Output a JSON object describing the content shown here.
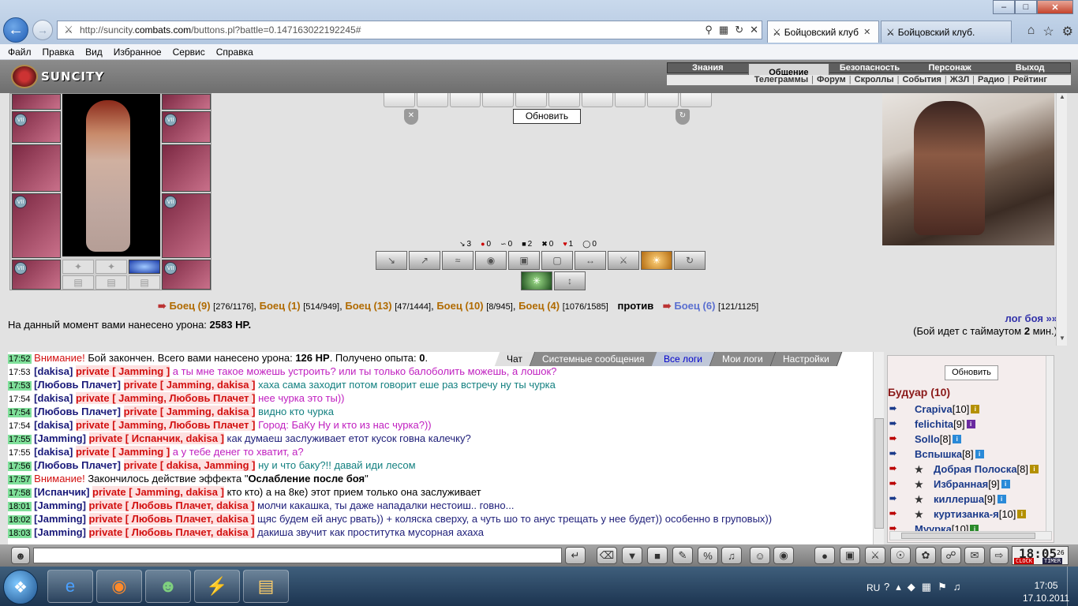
{
  "browser": {
    "url_prefix": "http://suncity.",
    "url_domain": "combats.com",
    "url_rest": "/buttons.pl?battle=0.147163022192245#",
    "tabs": [
      {
        "label": "Бойцовский клуб"
      },
      {
        "label": "Бойцовский клуб."
      }
    ],
    "menu": [
      "Файл",
      "Правка",
      "Вид",
      "Избранное",
      "Сервис",
      "Справка"
    ]
  },
  "game": {
    "logo": "SUNCITY",
    "topnav": [
      "Знания",
      "Общение",
      "Безопасность",
      "Персонаж",
      "Выход"
    ],
    "topnav_active": "Общение",
    "subnav": [
      "Телеграммы",
      "Форум",
      "Скроллы",
      "События",
      "ЖЗЛ",
      "Радио",
      "Рейтинг"
    ],
    "refresh_label": "Обновить",
    "stats": [
      {
        "icon": "sword-icon",
        "value": "3"
      },
      {
        "icon": "drop-icon",
        "value": "0"
      },
      {
        "icon": "hands-icon",
        "value": "0"
      },
      {
        "icon": "shield-icon",
        "value": "2"
      },
      {
        "icon": "cross-icon",
        "value": "0"
      },
      {
        "icon": "heart-icon",
        "value": "1"
      },
      {
        "icon": "defense-icon",
        "value": "0"
      }
    ],
    "teams": {
      "left": [
        {
          "name": "Боец (9)",
          "hp": "[276/1176]"
        },
        {
          "name": "Боец (1)",
          "hp": "[514/949]"
        },
        {
          "name": "Боец (13)",
          "hp": "[47/1444]"
        },
        {
          "name": "Боец (10)",
          "hp": "[8/945]"
        },
        {
          "name": "Боец (4)",
          "hp": "[1076/1585]"
        }
      ],
      "vs": "против",
      "right": [
        {
          "name": "Боец (6)",
          "hp": "[121/1125]"
        }
      ]
    },
    "damage_label": "На данный момент вами нанесено урона:",
    "damage_value": "2583 HP.",
    "battle_log": "лог боя »»",
    "timeout_pre": "(Бой идет с таймаутом ",
    "timeout_val": "2",
    "timeout_post": " мин.)"
  },
  "chat": {
    "tabs": [
      "Чат",
      "Системные сообщения",
      "Все логи",
      "Мои логи",
      "Настройки"
    ],
    "lines": [
      {
        "time": "17:52",
        "type": "sys",
        "pre": "Внимание!",
        "text": " Бой закончен. Всего вами нанесено урона: ",
        "b1": "126 HP",
        "mid": ". Получено опыта: ",
        "b2": "0",
        "end": "."
      },
      {
        "time": "17:53",
        "nick": "dakisa",
        "priv": "private [ Jamming ]",
        "cls": "txpink",
        "msg": "а ты мне такое можешь устроить? или ты только балоболить можешь, а лошок?"
      },
      {
        "time": "17:53",
        "nick": "Любовь Плачет",
        "priv": "private [ Jamming, dakisa ]",
        "cls": "txteal",
        "msg": "хаха сама заходит потом говорит еше раз встречу ну ты чурка"
      },
      {
        "time": "17:54",
        "nick": "dakisa",
        "priv": "private [ Jamming, Любовь Плачет ]",
        "cls": "txpink",
        "msg": "нее чурка это ты))"
      },
      {
        "time": "17:54",
        "nick": "Любовь Плачет",
        "priv": "private [ Jamming, dakisa ]",
        "cls": "txteal",
        "msg": "видно кто чурка"
      },
      {
        "time": "17:54",
        "nick": "dakisa",
        "priv": "private [ Jamming, Любовь Плачет ]",
        "cls": "txpink",
        "msg": "Город: БаКу Ну и кто из нас чурка?))"
      },
      {
        "time": "17:55",
        "nick": "Jamming",
        "priv": "private [ Испанчик, dakisa ]",
        "cls": "txblue",
        "msg": "как думаеш заслуживает етот кусок говна калечку?"
      },
      {
        "time": "17:55",
        "nick": "dakisa",
        "priv": "private [ Jamming ]",
        "cls": "txpink",
        "msg": "а у тебе денег то хватит, а?"
      },
      {
        "time": "17:56",
        "nick": "Любовь Плачет",
        "priv": "private [ dakisa, Jamming ]",
        "cls": "txteal",
        "msg": "ну и что баку?!! давай иди лесом"
      },
      {
        "time": "17:57",
        "type": "effect",
        "pre": "Внимание!",
        "text": " Закончилось действие эффекта \"",
        "b1": "Ослабление после боя",
        "end": "\""
      },
      {
        "time": "17:58",
        "nick": "Испанчик",
        "priv": "private [ Jamming, dakisa ]",
        "cls": "",
        "msg": "кто кто) а на 8ке) этот прием только она заслуживает"
      },
      {
        "time": "18:01",
        "nick": "Jamming",
        "priv": "private [ Любовь Плачет, dakisa ]",
        "cls": "txblue",
        "msg": "молчи какашка, ты даже нападалки нестоиш.. говно..."
      },
      {
        "time": "18:02",
        "nick": "Jamming",
        "priv": "private [ Любовь Плачет, dakisa ]",
        "cls": "txblue",
        "msg": "щяс будем ей анус рвать)) + коляска сверху, а чуть шо то анус трещать у нее будет)) особенно в груповых))"
      },
      {
        "time": "18:03",
        "nick": "Jamming",
        "priv": "private [ Любовь Плачет, dakisa ]",
        "cls": "txblue",
        "msg": "дакиша звучит как проститутка мусорная ахаха"
      }
    ]
  },
  "online": {
    "refresh_label": "Обновить",
    "room": "Будуар (10)",
    "players": [
      {
        "name": "Crapiva",
        "level": "[10]",
        "info": "ig"
      },
      {
        "name": "felichita",
        "level": "[9]",
        "info": "ip"
      },
      {
        "name": "Sollo",
        "level": "[8]",
        "info": "ib"
      },
      {
        "name": "Вспышка",
        "level": "[8]",
        "info": "ib"
      },
      {
        "name": "Добрая Полоска",
        "level": "[8]",
        "info": "ig",
        "clan": true
      },
      {
        "name": "Избранная",
        "level": "[9]",
        "info": "ib",
        "clan": true
      },
      {
        "name": "киллерша",
        "level": "[9]",
        "info": "ib",
        "clan": true
      },
      {
        "name": "куртизанка-я",
        "level": "[10]",
        "info": "ig",
        "clan": true
      },
      {
        "name": "Муурка",
        "level": "[10]",
        "info": "ig2"
      }
    ]
  },
  "clock": {
    "time": "18:05",
    "seconds": "26",
    "clock_label": "CLOCK",
    "timer_label": "TIMER"
  },
  "taskbar": {
    "lang": "RU",
    "time": "17:05",
    "date": "17.10.2011"
  }
}
